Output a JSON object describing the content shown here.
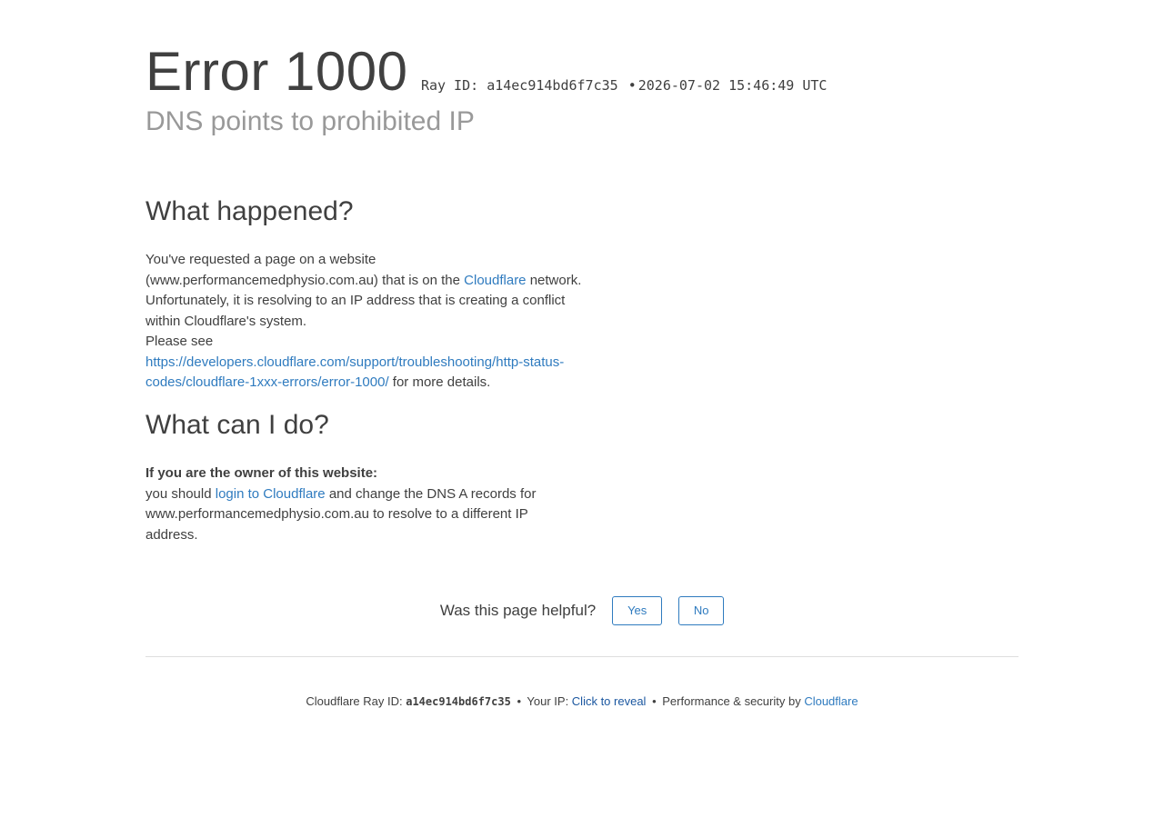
{
  "header": {
    "title": "Error 1000",
    "ray_prefix": "Ray ID: ",
    "ray_id": "a14ec914bd6f7c35",
    "separator": "•",
    "timestamp": "2026-07-02 15:46:49 UTC",
    "subtitle": "DNS points to prohibited IP"
  },
  "what_happened": {
    "heading": "What happened?",
    "text_1": "You've requested a page on a website (www.performancemedphysio.com.au) that is on the ",
    "link_cloudflare": "Cloudflare",
    "text_2": " network. Unfortunately, it is resolving to an IP address that is creating a conflict within Cloudflare's system.",
    "text_3": "Please see",
    "link_docs": "https://developers.cloudflare.com/support/troubleshooting/http-status-codes/cloudflare-1xxx-errors/error-1000/",
    "text_4": " for more details."
  },
  "what_can_i_do": {
    "heading": "What can I do?",
    "owner_label": "If you are the owner of this website:",
    "text_1": "you should ",
    "link_login": "login to Cloudflare",
    "text_2": " and change the DNS A records for www.performancemedphysio.com.au to resolve to a different IP address."
  },
  "feedback": {
    "question": "Was this page helpful?",
    "yes_label": "Yes",
    "no_label": "No"
  },
  "footer": {
    "ray_label": "Cloudflare Ray ID: ",
    "ray_id": "a14ec914bd6f7c35",
    "bullet": "•",
    "ip_label": "Your IP: ",
    "ip_link": "Click to reveal",
    "perf_label": "Performance & security by ",
    "perf_link": "Cloudflare"
  },
  "colors": {
    "link": "#2f7bbf",
    "text": "#404040",
    "subtitle": "#999999",
    "divider": "#dedede"
  }
}
